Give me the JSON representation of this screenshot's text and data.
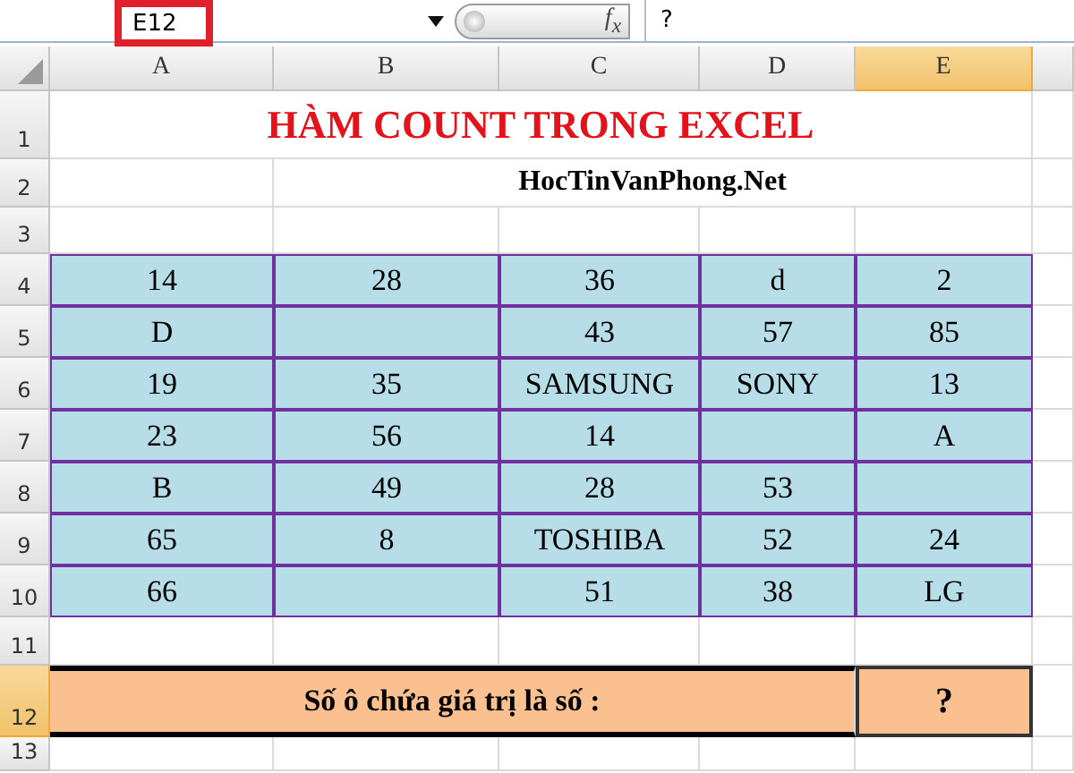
{
  "formula_bar": {
    "name_box": "E12",
    "fx": "f$_{x}$",
    "formula": "?"
  },
  "columns": [
    {
      "label": "A",
      "selected": false
    },
    {
      "label": "B",
      "selected": false
    },
    {
      "label": "C",
      "selected": false
    },
    {
      "label": "D",
      "selected": false
    },
    {
      "label": "E",
      "selected": true
    }
  ],
  "rows": [
    {
      "number": "1",
      "selected": false,
      "kind": "title",
      "text": "HÀM COUNT TRONG EXCEL"
    },
    {
      "number": "2",
      "selected": false,
      "kind": "subtitle",
      "text": "HocTinVanPhong.Net"
    },
    {
      "number": "3",
      "selected": false,
      "kind": "blank"
    },
    {
      "number": "4",
      "selected": false,
      "kind": "data",
      "cells": [
        "14",
        "28",
        "36",
        "d",
        "2"
      ]
    },
    {
      "number": "5",
      "selected": false,
      "kind": "data",
      "cells": [
        "D",
        "",
        "43",
        "57",
        "85"
      ]
    },
    {
      "number": "6",
      "selected": false,
      "kind": "data",
      "cells": [
        "19",
        "35",
        "SAMSUNG",
        "SONY",
        "13"
      ]
    },
    {
      "number": "7",
      "selected": false,
      "kind": "data",
      "cells": [
        "23",
        "56",
        "14",
        "",
        "A"
      ]
    },
    {
      "number": "8",
      "selected": false,
      "kind": "data",
      "cells": [
        "B",
        "49",
        "28",
        "53",
        ""
      ]
    },
    {
      "number": "9",
      "selected": false,
      "kind": "data",
      "cells": [
        "65",
        "8",
        "TOSHIBA",
        "52",
        "24"
      ]
    },
    {
      "number": "10",
      "selected": false,
      "kind": "data",
      "cells": [
        "66",
        "",
        "51",
        "38",
        "LG"
      ]
    },
    {
      "number": "11",
      "selected": false,
      "kind": "blank"
    },
    {
      "number": "12",
      "selected": true,
      "kind": "result",
      "label": "Số ô chứa giá trị là số :",
      "value": "?"
    },
    {
      "number": "13",
      "selected": false,
      "kind": "blank"
    }
  ]
}
